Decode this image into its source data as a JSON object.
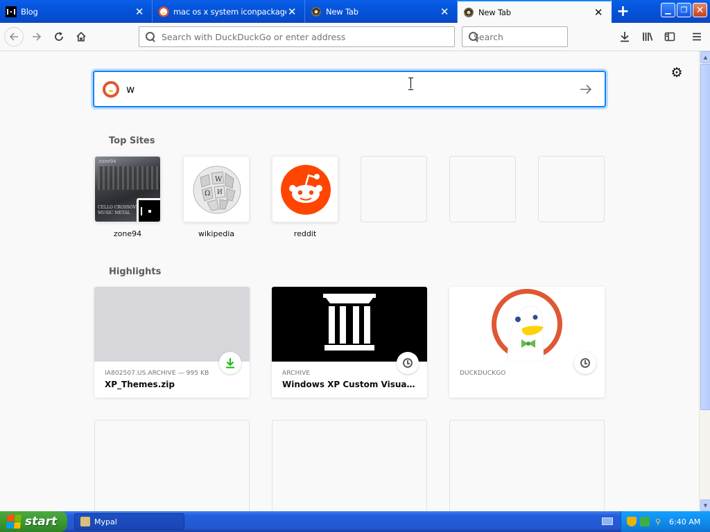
{
  "tabs": [
    {
      "title": "Blog",
      "icon": "zone94-favicon",
      "active": false
    },
    {
      "title": "mac os x system iconpackager at",
      "icon": "duckduckgo-favicon",
      "active": false
    },
    {
      "title": "New Tab",
      "icon": "firefox-favicon",
      "active": false
    },
    {
      "title": "New Tab",
      "icon": "firefox-favicon",
      "active": true
    }
  ],
  "toolbar": {
    "url_placeholder": "Search with DuckDuckGo or enter address",
    "search_placeholder": "Search"
  },
  "newtab": {
    "search_value": "w",
    "top_sites_title": "Top Sites",
    "highlights_title": "Highlights",
    "top_sites": [
      {
        "label": "zone94",
        "thumb_caption": "CELLO CROSSOVER MUSIC METAL",
        "thumb_logo": "zone94"
      },
      {
        "label": "wikipedia"
      },
      {
        "label": "reddit"
      }
    ],
    "highlights": [
      {
        "source": "IA802507.US.ARCHIVE — 995 KB",
        "title": "XP_Themes.zip",
        "badge": "download-icon"
      },
      {
        "source": "ARCHIVE",
        "title": "Windows XP Custom Visual Style...",
        "badge": "clock-icon"
      },
      {
        "source": "DUCKDUCKGO",
        "title": "",
        "badge": "clock-icon"
      }
    ]
  },
  "taskbar": {
    "start_label": "start",
    "task_label": "Mypal",
    "clock": "6:40 AM"
  },
  "colors": {
    "accent": "#0a84ff",
    "xp_caption": "#0350d4",
    "reddit": "#ff4500",
    "duckduckgo": "#de5833",
    "download_green": "#12bc00"
  }
}
